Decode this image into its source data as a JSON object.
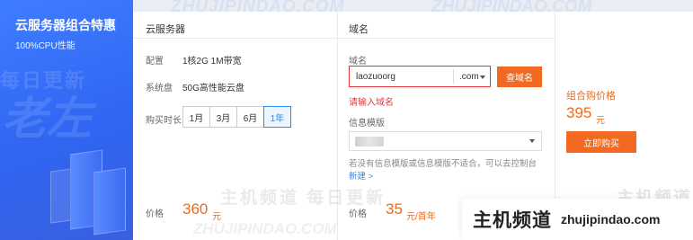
{
  "promo": {
    "title": "云服务器组合特惠",
    "subtitle": "100%CPU性能",
    "watermark_small": "每日更新",
    "watermark_big": "老左"
  },
  "cloud": {
    "heading": "云服务器",
    "config_label": "配置",
    "config_value": "1核2G  1M带宽",
    "disk_label": "系统盘",
    "disk_value": "50G高性能云盘",
    "duration_label": "购买时长",
    "durations": [
      "1月",
      "3月",
      "6月",
      "1年"
    ],
    "selected_duration": "1年",
    "price_label": "价格",
    "price": "360",
    "price_unit": "元"
  },
  "domain": {
    "heading": "域名",
    "field_label": "域名",
    "input_value": "laozuoorg",
    "suffix": ".com",
    "query_button": "查域名",
    "error": "请输入域名",
    "template_label": "信息模版",
    "hint_text": "若没有信息模版或信息模版不适合，可以去控制台 ",
    "hint_link": "新建 >",
    "price_label": "价格",
    "price": "35",
    "price_unit": "元/首年"
  },
  "buy": {
    "label": "组合购价格",
    "price": "395",
    "unit": "元",
    "button": "立即购买"
  },
  "watermarks": {
    "url_caps": "ZHUJIPINDAO.COM",
    "cn": "主机频道 每日更新",
    "cn_right": "主机频道"
  },
  "brand": {
    "cn": "主机频道",
    "url": "zhujipindao.com"
  },
  "colors": {
    "accent_orange": "#f26a21",
    "error_red": "#e4393c",
    "link_blue": "#2d8cf0",
    "promo_blue": "#2f66f2"
  }
}
